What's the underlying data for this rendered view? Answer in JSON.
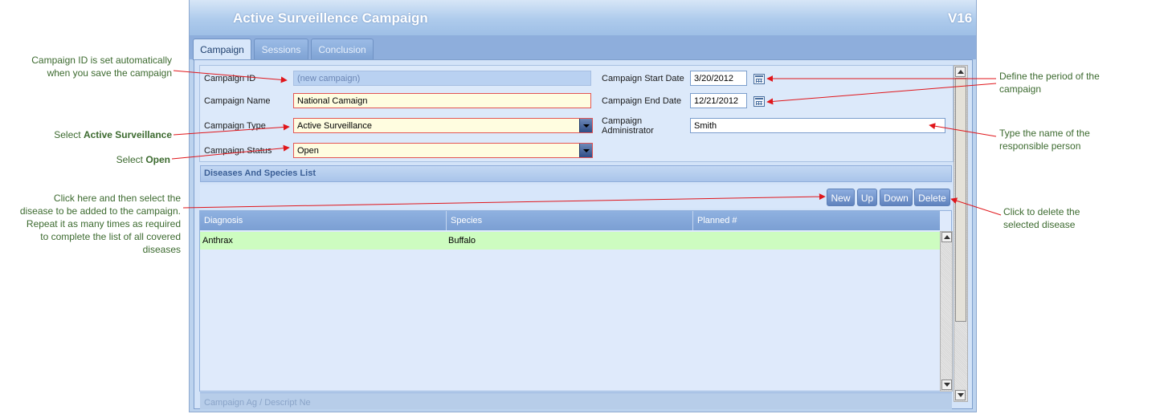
{
  "window": {
    "title": "Active Surveillence Campaign",
    "version": "V16"
  },
  "tabs": [
    {
      "label": "Campaign",
      "active": true
    },
    {
      "label": "Sessions",
      "active": false
    },
    {
      "label": "Conclusion",
      "active": false
    }
  ],
  "form": {
    "campaign_id": {
      "label": "Campaign ID",
      "value": "(new campaign)"
    },
    "campaign_name": {
      "label": "Campaign Name",
      "value": "National Camaign"
    },
    "campaign_type": {
      "label": "Campaign Type",
      "value": "Active Surveillance"
    },
    "campaign_status": {
      "label": "Campaign Status",
      "value": "Open"
    },
    "start_date": {
      "label": "Campaign Start Date",
      "value": "3/20/2012"
    },
    "end_date": {
      "label": "Campaign End Date",
      "value": "12/21/2012"
    },
    "administrator": {
      "label_line1": "Campaign",
      "label_line2": "Administrator",
      "value": "Smith"
    }
  },
  "diseases_section": {
    "title": "Diseases And Species List",
    "buttons": {
      "new": "New",
      "up": "Up",
      "down": "Down",
      "delete": "Delete"
    },
    "columns": [
      "Diagnosis",
      "Species",
      "Planned #"
    ],
    "rows": [
      {
        "diagnosis": "Anthrax",
        "species": "Buffalo",
        "planned": ""
      }
    ]
  },
  "bottom_section": {
    "title": "Campaign Ag / Descript Ne"
  },
  "annotations": {
    "campaign_id_line1": "Campaign ID is set automatically",
    "campaign_id_line2": "when you save the campaign",
    "type_prefix": "Select",
    "type_bold": "Active Surveillance",
    "status_prefix": "Select",
    "status_bold": "Open",
    "new_line1": "Click here and then select the",
    "new_line2": "disease to be added to the campaign.",
    "new_line3": "Repeat it as many times as required",
    "new_line4": "to complete the list of all covered",
    "new_line5": "diseases",
    "period_line1": "Define the period of the",
    "period_line2": "campaign",
    "admin_line1": "Type the name of the",
    "admin_line2": "responsible person",
    "delete_line1": "Click to delete the",
    "delete_line2": "selected disease"
  },
  "colors": {
    "annotation_text": "#3c6a2f",
    "arrow": "#e0161b",
    "selected_row": "#cdfcc0",
    "required_field_border": "#e25555"
  }
}
